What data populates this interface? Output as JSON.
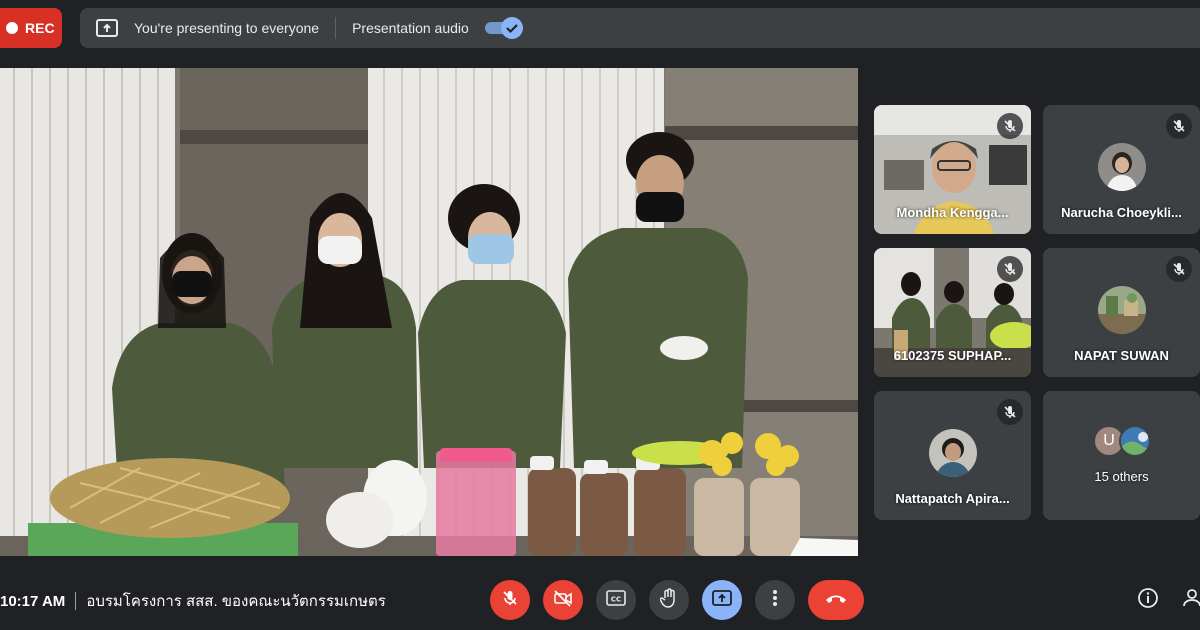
{
  "top_bar": {
    "rec_label": "REC",
    "presenting_text": "You're presenting to everyone",
    "presentation_audio_label": "Presentation audio"
  },
  "participants": [
    {
      "name": "Mondha Kengga...",
      "muted": true
    },
    {
      "name": "Narucha Choeykli...",
      "muted": true
    },
    {
      "name": "6102375 SUPHAP...",
      "muted": true
    },
    {
      "name": "NAPAT SUWAN",
      "muted": true
    },
    {
      "name": "Nattapatch Apira...",
      "muted": true
    },
    {
      "name": "15 others",
      "avatar_letter": "U"
    }
  ],
  "bottom_bar": {
    "time": "10:17 AM",
    "meeting_title": "อบรมโครงการ สสส. ของคณะนวัตกรรมเกษตร"
  },
  "colors": {
    "rec_red": "#d93025",
    "accent_blue": "#8ab4f8",
    "end_call_red": "#ea4335",
    "panel_gray": "#3c4043",
    "background": "#202124"
  },
  "icons": {
    "mic": "mic-off-icon",
    "camera": "videocam-off-icon",
    "captions": "closed-caption-icon",
    "raise_hand": "hand-icon",
    "present": "present-screen-icon",
    "more": "more-vert-icon",
    "end_call": "call-end-icon",
    "info": "info-icon",
    "people": "people-icon"
  }
}
